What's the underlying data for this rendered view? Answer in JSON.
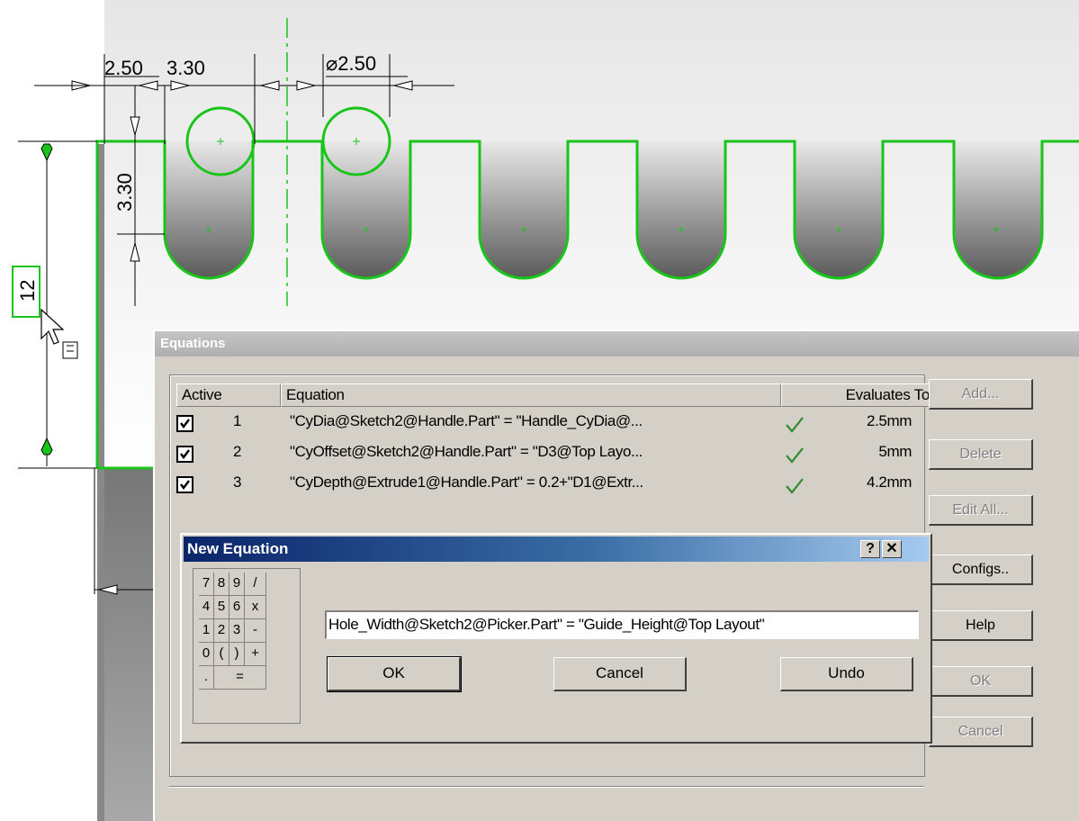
{
  "sketch": {
    "dimensions": {
      "top_left": "2.50",
      "top_mid": "3.30",
      "diameter": "⌀2.50",
      "vertical_small": "3.30",
      "height_box": "12"
    }
  },
  "equations_dialog": {
    "title": "Equations",
    "columns": {
      "active": "Active",
      "equation": "Equation",
      "evaluates": "Evaluates To"
    },
    "rows": [
      {
        "index": "1",
        "active": true,
        "equation": "\"CyDia@Sketch2@Handle.Part\" = \"Handle_CyDia@...",
        "value": "2.5mm"
      },
      {
        "index": "2",
        "active": true,
        "equation": "\"CyOffset@Sketch2@Handle.Part\" = \"D3@Top Layo...",
        "value": "5mm"
      },
      {
        "index": "3",
        "active": true,
        "equation": "\"CyDepth@Extrude1@Handle.Part\" = 0.2+\"D1@Extr...",
        "value": "4.2mm"
      }
    ],
    "buttons": {
      "add": "Add...",
      "delete": "Delete",
      "edit_all": "Edit All...",
      "configs": "Configs..",
      "help": "Help",
      "ok": "OK",
      "cancel": "Cancel"
    }
  },
  "new_equation": {
    "title": "New Equation",
    "help_btn": "?",
    "close_btn": "✕",
    "keypad": {
      "row1": [
        "7",
        "8",
        "9",
        "/"
      ],
      "row2": [
        "4",
        "5",
        "6",
        "x"
      ],
      "row3": [
        "1",
        "2",
        "3",
        "-"
      ],
      "row4": [
        "0",
        "(",
        ")",
        "+"
      ],
      "row5": [
        ".",
        "="
      ]
    },
    "input_value": "Hole_Width@Sketch2@Picker.Part\" = \"Guide_Height@Top Layout\"",
    "ok": "OK",
    "cancel": "Cancel",
    "undo": "Undo"
  },
  "colors": {
    "sketch_green": "#19c519",
    "title_blue": "#0a246a",
    "dialog_gray": "#d4d0c8"
  }
}
